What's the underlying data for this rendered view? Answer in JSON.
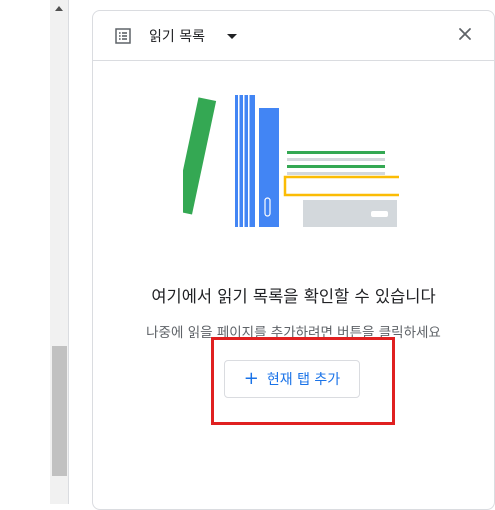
{
  "colors": {
    "accent": "#1a73e8",
    "highlight": "#e02020",
    "book_green": "#34a853",
    "book_blue": "#4285f4",
    "book_yellow": "#fbbc04",
    "book_gray": "#d3d8dc"
  },
  "scrollbar": {
    "up_icon": "triangle-up-icon"
  },
  "panel": {
    "header": {
      "icon": "list-icon",
      "title": "읽기 목록",
      "dropdown_icon": "caret-down-icon",
      "close_icon": "close-icon"
    },
    "empty_state": {
      "title": "여기에서 읽기 목록을 확인할 수 있습니다",
      "subtitle": "나중에 읽을 페이지를 추가하려면 버튼을 클릭하세요",
      "add_button": {
        "icon": "plus-icon",
        "plus": "+",
        "label": "현재 탭 추가"
      }
    }
  }
}
